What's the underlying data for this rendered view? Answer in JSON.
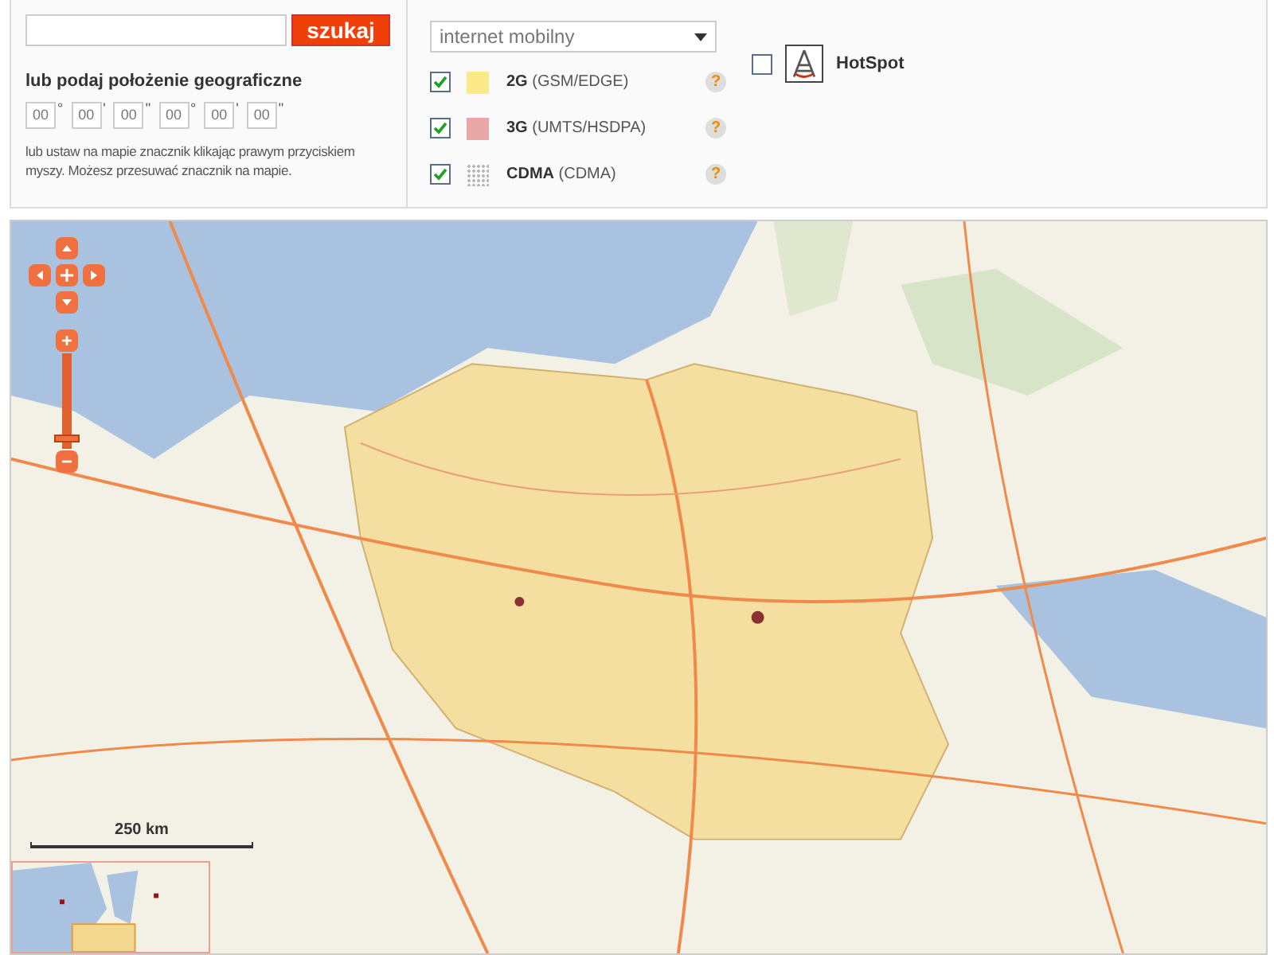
{
  "search": {
    "button": "szukaj"
  },
  "geo": {
    "heading": "lub podaj położenie geograficzne",
    "coords": [
      {
        "value": "00",
        "mark": "°"
      },
      {
        "value": "00",
        "mark": "'"
      },
      {
        "value": "00",
        "mark": "\""
      },
      {
        "value": "00",
        "mark": "°"
      },
      {
        "value": "00",
        "mark": "'"
      },
      {
        "value": "00",
        "mark": "\""
      }
    ],
    "hint": "lub ustaw na mapie znacznik klikając prawym przyciskiem myszy. Możesz przesuwać znacznik na mapie."
  },
  "layer_select": {
    "value": "internet mobilny"
  },
  "layers": [
    {
      "kind": "fill",
      "checked": true,
      "color": "#fce98a",
      "name": "2G",
      "detail": "(GSM/EDGE)",
      "help": "?"
    },
    {
      "kind": "fill",
      "checked": true,
      "color": "#e8a6a6",
      "name": "3G",
      "detail": "(UMTS/HSDPA)",
      "help": "?"
    },
    {
      "kind": "pattern",
      "checked": true,
      "color": "#b8b8b8",
      "name": "CDMA",
      "detail": "(CDMA)",
      "help": "?"
    }
  ],
  "hotspot": {
    "checked": false,
    "label": "HotSpot"
  },
  "map": {
    "zoom": {
      "in": "+",
      "out": "−",
      "level": 0.08
    },
    "scale": "250 km"
  }
}
